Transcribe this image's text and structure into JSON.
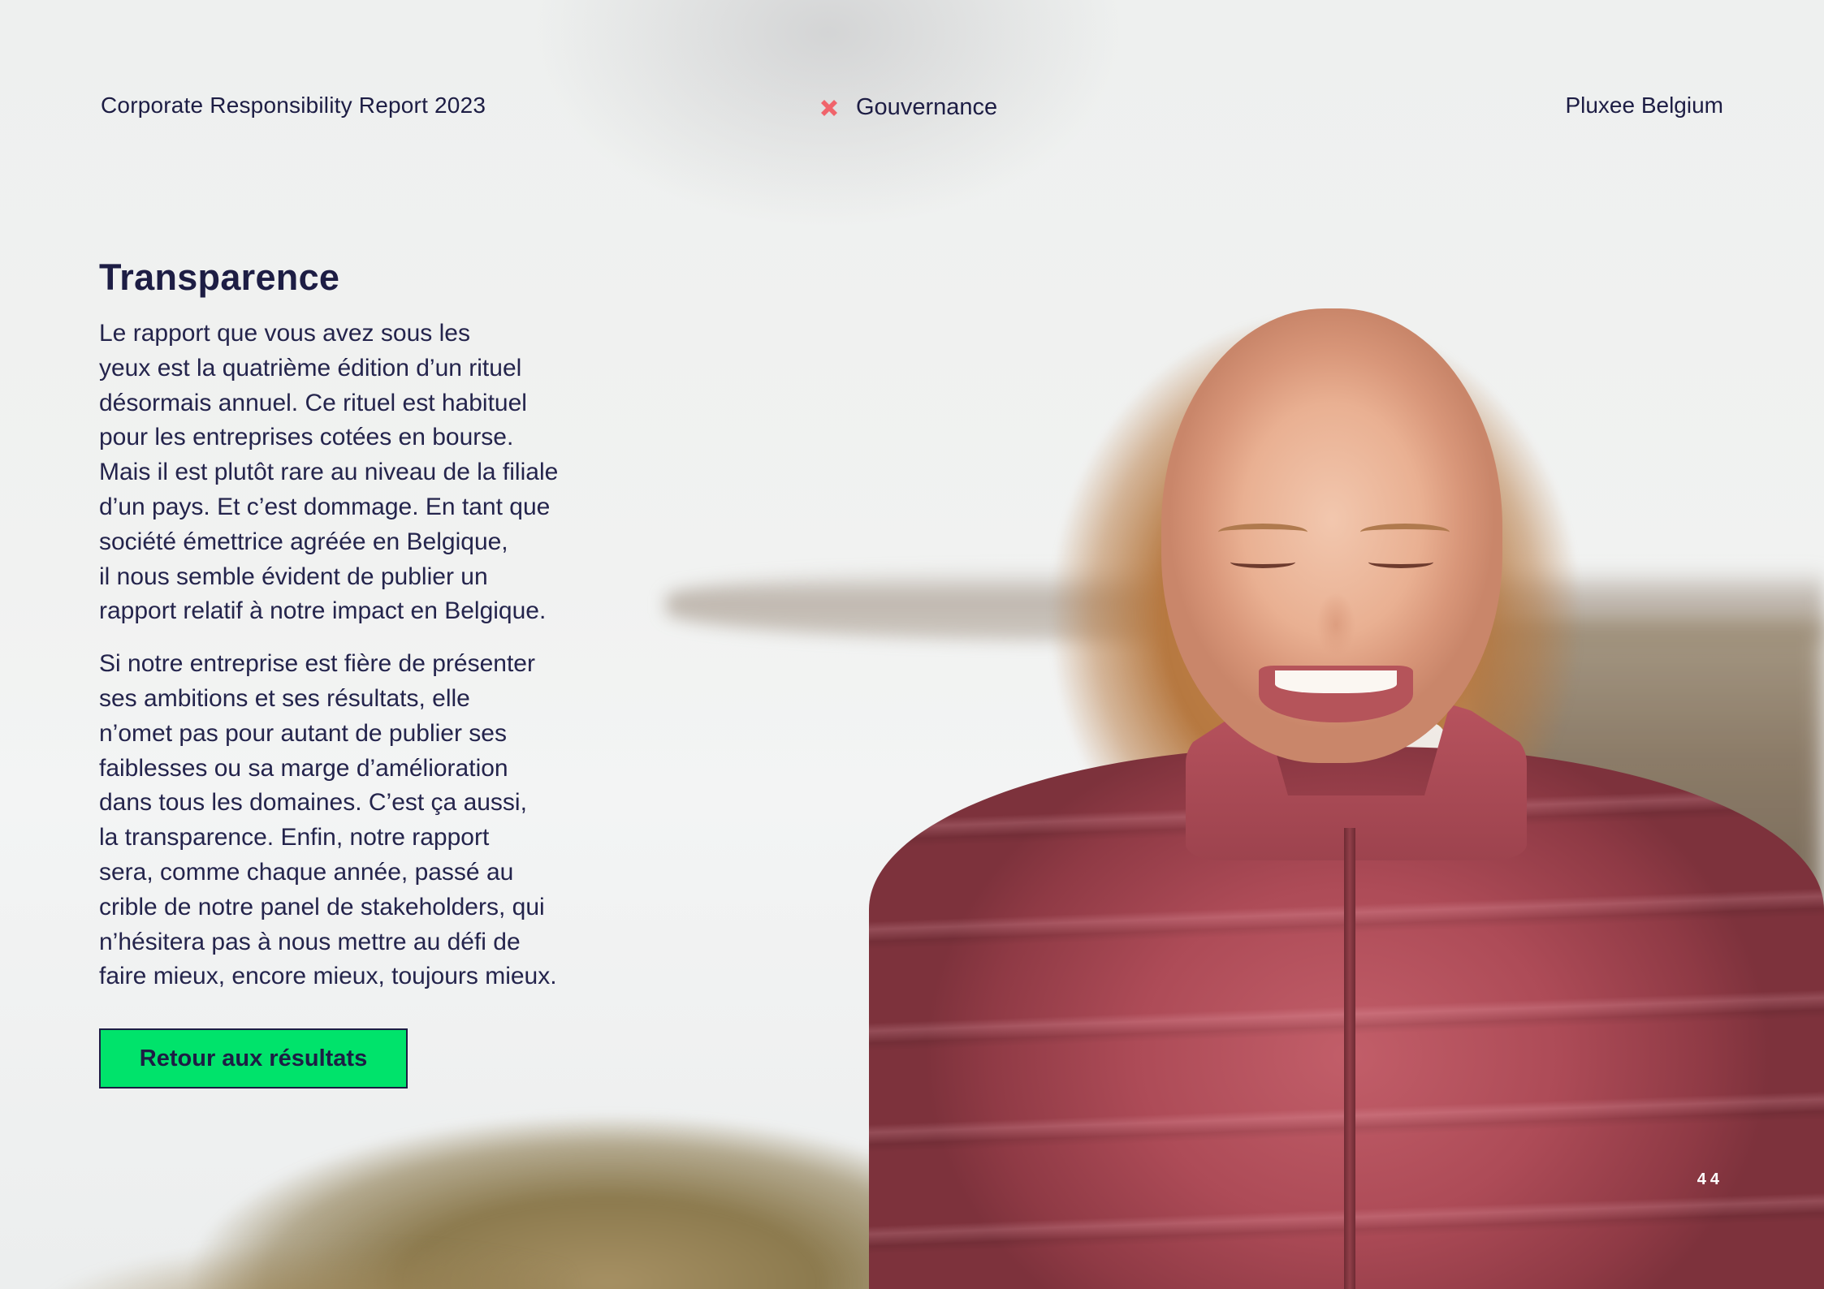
{
  "header": {
    "running_title": "Corporate Responsibility Report 2023",
    "section": "Gouvernance",
    "section_icon": "x-mark-icon",
    "brand": "Pluxee Belgium"
  },
  "content": {
    "title": "Transparence",
    "paragraphs": [
      "Le rapport que vous avez sous les\nyeux est la quatrième édition d’un rituel\ndésormais annuel. Ce rituel est habituel\npour les entreprises cotées en bourse.\nMais il est plutôt rare au niveau de la filiale\nd’un pays. Et c’est dommage. En tant que\nsociété émettrice agréée en Belgique,\nil nous semble évident de publier un\nrapport relatif à notre impact en Belgique.",
      "Si notre entreprise est fière de présenter\nses ambitions et ses résultats, elle\nn’omet pas pour autant de publier ses\nfaiblesses ou sa marge d’amélioration\ndans tous les domaines. C’est ça aussi,\nla transparence. Enfin, notre rapport\nsera, comme chaque année, passé au\ncrible de notre panel de stakeholders, qui\nn’hésitera pas à nous mettre au défi de\nfaire mieux, encore mieux, toujours mieux."
    ],
    "cta_label": "Retour aux résultats"
  },
  "footer": {
    "page_number": "44"
  },
  "colors": {
    "text": "#1d1d44",
    "accent_icon": "#f0646b",
    "cta_background": "#00e36b"
  }
}
